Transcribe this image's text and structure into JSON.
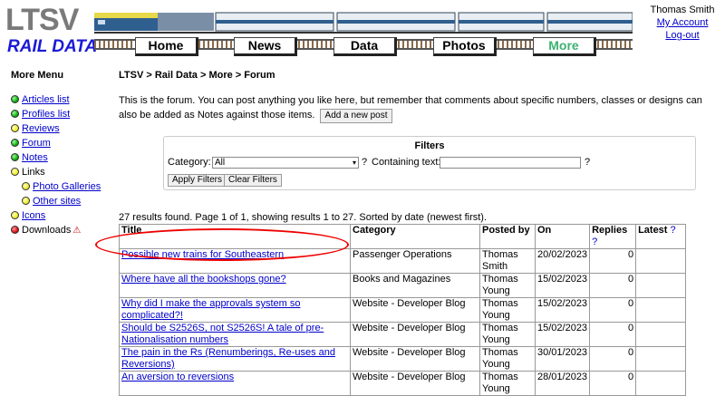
{
  "header": {
    "logo_top": "LTSV",
    "logo_bottom": "RAIL DATA",
    "nav": [
      "Home",
      "News",
      "Data",
      "Photos",
      "More"
    ],
    "active_nav": "More",
    "user_name": "Thomas Smith",
    "my_account": "My Account",
    "logout": "Log-out"
  },
  "sidebar": {
    "title": "More Menu",
    "items": [
      {
        "label": "Articles list",
        "dot": "green",
        "link": true,
        "sub": false
      },
      {
        "label": "Profiles list",
        "dot": "green",
        "link": true,
        "sub": false
      },
      {
        "label": "Reviews",
        "dot": "yellow",
        "link": true,
        "sub": false
      },
      {
        "label": "Forum",
        "dot": "green",
        "link": true,
        "sub": false
      },
      {
        "label": "Notes",
        "dot": "green",
        "link": true,
        "sub": false
      },
      {
        "label": "Links",
        "dot": "yellow",
        "link": false,
        "sub": false
      },
      {
        "label": "Photo Galleries",
        "dot": "yellow",
        "link": true,
        "sub": true
      },
      {
        "label": "Other sites",
        "dot": "yellow",
        "link": true,
        "sub": true
      },
      {
        "label": "Icons",
        "dot": "yellow",
        "link": true,
        "sub": false
      },
      {
        "label": "Downloads",
        "dot": "red",
        "link": false,
        "sub": false,
        "warning": true
      }
    ]
  },
  "main": {
    "breadcrumb": "LTSV > Rail Data > More > Forum",
    "intro": "This is the forum. You can post anything you like here, but remember that comments about specific numbers, classes or designs can also be added as Notes against those items.",
    "add_post": "Add a new post",
    "filters": {
      "title": "Filters",
      "category_label": "Category:",
      "category_value": "All",
      "help": "?",
      "containing_label": "Containing text:",
      "apply": "Apply Filters",
      "clear": "Clear Filters"
    },
    "results_text": "27 results found. Page 1 of 1, showing results 1 to 27. Sorted by date (newest first).",
    "table": {
      "headers": [
        "Title",
        "Category",
        "Posted by",
        "On",
        "Replies",
        "Latest"
      ],
      "rows": [
        {
          "title": "Possible new trains for Southeastern",
          "category": "Passenger Operations",
          "posted_by": "Thomas Smith",
          "on": "20/02/2023",
          "replies": "0"
        },
        {
          "title": "Where have all the bookshops gone?",
          "category": "Books and Magazines",
          "posted_by": "Thomas Young",
          "on": "15/02/2023",
          "replies": "0"
        },
        {
          "title": "Why did I make the approvals system so complicated?!",
          "category": "Website - Developer Blog",
          "posted_by": "Thomas Young",
          "on": "15/02/2023",
          "replies": "0"
        },
        {
          "title": "Should be S2526S, not S2526S! A tale of pre-Nationalisation numbers",
          "category": "Website - Developer Blog",
          "posted_by": "Thomas Young",
          "on": "15/02/2023",
          "replies": "0"
        },
        {
          "title": "The pain in the Rs (Renumberings, Re-uses and Reversions)",
          "category": "Website - Developer Blog",
          "posted_by": "Thomas Young",
          "on": "30/01/2023",
          "replies": "0"
        },
        {
          "title": "An aversion to reversions",
          "category": "Website - Developer Blog",
          "posted_by": "Thomas Young",
          "on": "28/01/2023",
          "replies": "0"
        }
      ]
    }
  },
  "colors": {
    "link": "#0000cc",
    "active_nav": "#3cb371",
    "highlight_circle": "#ee0000"
  }
}
